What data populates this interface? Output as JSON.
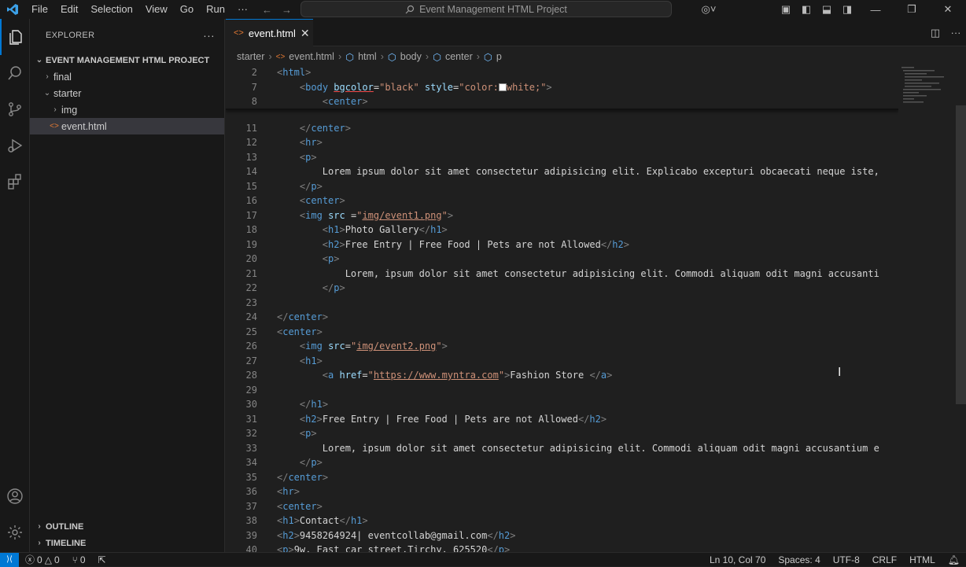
{
  "menubar": {
    "items": [
      "File",
      "Edit",
      "Selection",
      "View",
      "Go",
      "Run",
      "···"
    ]
  },
  "title": "Event Management HTML Project",
  "sidebar": {
    "header": "EXPLORER",
    "more": "···",
    "project": "EVENT MANAGEMENT HTML PROJECT",
    "folders": [
      "final",
      "starter",
      "img"
    ],
    "file": "event.html",
    "outline": "OUTLINE",
    "timeline": "TIMELINE"
  },
  "tab": {
    "label": "event.html"
  },
  "breadcrumb": [
    "starter",
    "event.html",
    "html",
    "body",
    "center",
    "p"
  ],
  "code_lines": [
    {
      "n": "2",
      "html": "<span class='t'>&lt;</span><span class='tg'>html</span><span class='t'>&gt;</span>"
    },
    {
      "n": "7",
      "html": "    <span class='t'>&lt;</span><span class='tg'>body</span> <span class='at ul' style='text-decoration-color:#f14c4c'>bgcolor</span><span class='tx'>=</span><span class='st'>\"black\"</span> <span class='at'>style</span><span class='tx'>=</span><span class='st'>\"color:</span><span style='display:inline-block;width:10px;height:10px;background:#fff;border:1px solid #888;vertical-align:-1px'></span><span class='st'>white;\"</span><span class='t'>&gt;</span>"
    },
    {
      "n": "8",
      "html": "        <span class='t'>&lt;</span><span class='tg'>center</span><span class='t'>&gt;</span>"
    },
    {
      "n": "11",
      "html": "    <span class='t'>&lt;/</span><span class='tg'>center</span><span class='t'>&gt;</span>"
    },
    {
      "n": "12",
      "html": "    <span class='t'>&lt;</span><span class='tg'>hr</span><span class='t'>&gt;</span>"
    },
    {
      "n": "13",
      "html": "    <span class='t'>&lt;</span><span class='tg'>p</span><span class='t'>&gt;</span>"
    },
    {
      "n": "14",
      "html": "        <span class='tx'>Lorem ipsum dolor sit amet consectetur adipisicing elit. Explicabo excepturi obcaecati neque iste,</span>"
    },
    {
      "n": "15",
      "html": "    <span class='t'>&lt;/</span><span class='tg'>p</span><span class='t'>&gt;</span>"
    },
    {
      "n": "16",
      "html": "    <span class='t'>&lt;</span><span class='tg'>center</span><span class='t'>&gt;</span>"
    },
    {
      "n": "17",
      "html": "    <span class='t'>&lt;</span><span class='tg'>img</span> <span class='at'>src</span> <span class='tx'>=</span><span class='st'>\"<span class='ul'>img/event1.png</span>\"</span><span class='t'>&gt;</span>"
    },
    {
      "n": "18",
      "html": "        <span class='t'>&lt;</span><span class='tg'>h1</span><span class='t'>&gt;</span><span class='tx'>Photo Gallery</span><span class='t'>&lt;/</span><span class='tg'>h1</span><span class='t'>&gt;</span>"
    },
    {
      "n": "19",
      "html": "        <span class='t'>&lt;</span><span class='tg'>h2</span><span class='t'>&gt;</span><span class='tx'>Free Entry | Free Food | Pets are not Allowed</span><span class='t'>&lt;/</span><span class='tg'>h2</span><span class='t'>&gt;</span>"
    },
    {
      "n": "20",
      "html": "        <span class='t'>&lt;</span><span class='tg'>p</span><span class='t'>&gt;</span>"
    },
    {
      "n": "21",
      "html": "            <span class='tx'>Lorem, ipsum dolor sit amet consectetur adipisicing elit. Commodi aliquam odit magni accusanti</span>"
    },
    {
      "n": "22",
      "html": "        <span class='t'>&lt;/</span><span class='tg'>p</span><span class='t'>&gt;</span>"
    },
    {
      "n": "23",
      "html": ""
    },
    {
      "n": "24",
      "html": "<span class='t'>&lt;/</span><span class='tg'>center</span><span class='t'>&gt;</span>"
    },
    {
      "n": "25",
      "html": "<span class='t'>&lt;</span><span class='tg'>center</span><span class='t'>&gt;</span>"
    },
    {
      "n": "26",
      "html": "    <span class='t'>&lt;</span><span class='tg'>img</span> <span class='at'>src</span><span class='tx'>=</span><span class='st'>\"<span class='ul'>img/event2.png</span>\"</span><span class='t'>&gt;</span>"
    },
    {
      "n": "27",
      "html": "    <span class='t'>&lt;</span><span class='tg'>h1</span><span class='t'>&gt;</span>"
    },
    {
      "n": "28",
      "html": "        <span class='t'>&lt;</span><span class='tg'>a</span> <span class='at'>href</span><span class='tx'>=</span><span class='st'>\"<span class='ul'>https://www.myntra.com</span>\"</span><span class='t'>&gt;</span><span class='tx'>Fashion Store </span><span class='t'>&lt;/</span><span class='tg'>a</span><span class='t'>&gt;</span>"
    },
    {
      "n": "29",
      "html": ""
    },
    {
      "n": "30",
      "html": "    <span class='t'>&lt;/</span><span class='tg'>h1</span><span class='t'>&gt;</span>"
    },
    {
      "n": "31",
      "html": "    <span class='t'>&lt;</span><span class='tg'>h2</span><span class='t'>&gt;</span><span class='tx'>Free Entry | Free Food | Pets are not Allowed</span><span class='t'>&lt;/</span><span class='tg'>h2</span><span class='t'>&gt;</span>"
    },
    {
      "n": "32",
      "html": "    <span class='t'>&lt;</span><span class='tg'>p</span><span class='t'>&gt;</span>"
    },
    {
      "n": "33",
      "html": "        <span class='tx'>Lorem, ipsum dolor sit amet consectetur adipisicing elit. Commodi aliquam odit magni accusantium e</span>"
    },
    {
      "n": "34",
      "html": "    <span class='t'>&lt;/</span><span class='tg'>p</span><span class='t'>&gt;</span>"
    },
    {
      "n": "35",
      "html": "<span class='t'>&lt;/</span><span class='tg'>center</span><span class='t'>&gt;</span>"
    },
    {
      "n": "36",
      "html": "<span class='t'>&lt;</span><span class='tg'>hr</span><span class='t'>&gt;</span>"
    },
    {
      "n": "37",
      "html": "<span class='t'>&lt;</span><span class='tg'>center</span><span class='t'>&gt;</span>"
    },
    {
      "n": "38",
      "html": "<span class='t'>&lt;</span><span class='tg'>h1</span><span class='t'>&gt;</span><span class='tx'>Contact</span><span class='t'>&lt;/</span><span class='tg'>h1</span><span class='t'>&gt;</span>"
    },
    {
      "n": "39",
      "html": "<span class='t'>&lt;</span><span class='tg'>h2</span><span class='t'>&gt;</span><span class='tx'>9458264924| eventcollab@gmail.com</span><span class='t'>&lt;/</span><span class='tg'>h2</span><span class='t'>&gt;</span>"
    },
    {
      "n": "40",
      "html": "<span class='t'>&lt;</span><span class='tg'>p</span><span class='t'>&gt;</span><span class='tx'>9w, East car street,Tirchy, 625520</span><span class='t'>&lt;/</span><span class='tg'>p</span><span class='t'>&gt;</span>"
    }
  ],
  "status": {
    "errors": "0",
    "warnings": "0",
    "ports": "0",
    "position": "Ln 10, Col 70",
    "spaces": "Spaces: 4",
    "encoding": "UTF-8",
    "eol": "CRLF",
    "language": "HTML"
  },
  "colors": {
    "accent": "#0078d4",
    "html_icon": "#e37933"
  }
}
